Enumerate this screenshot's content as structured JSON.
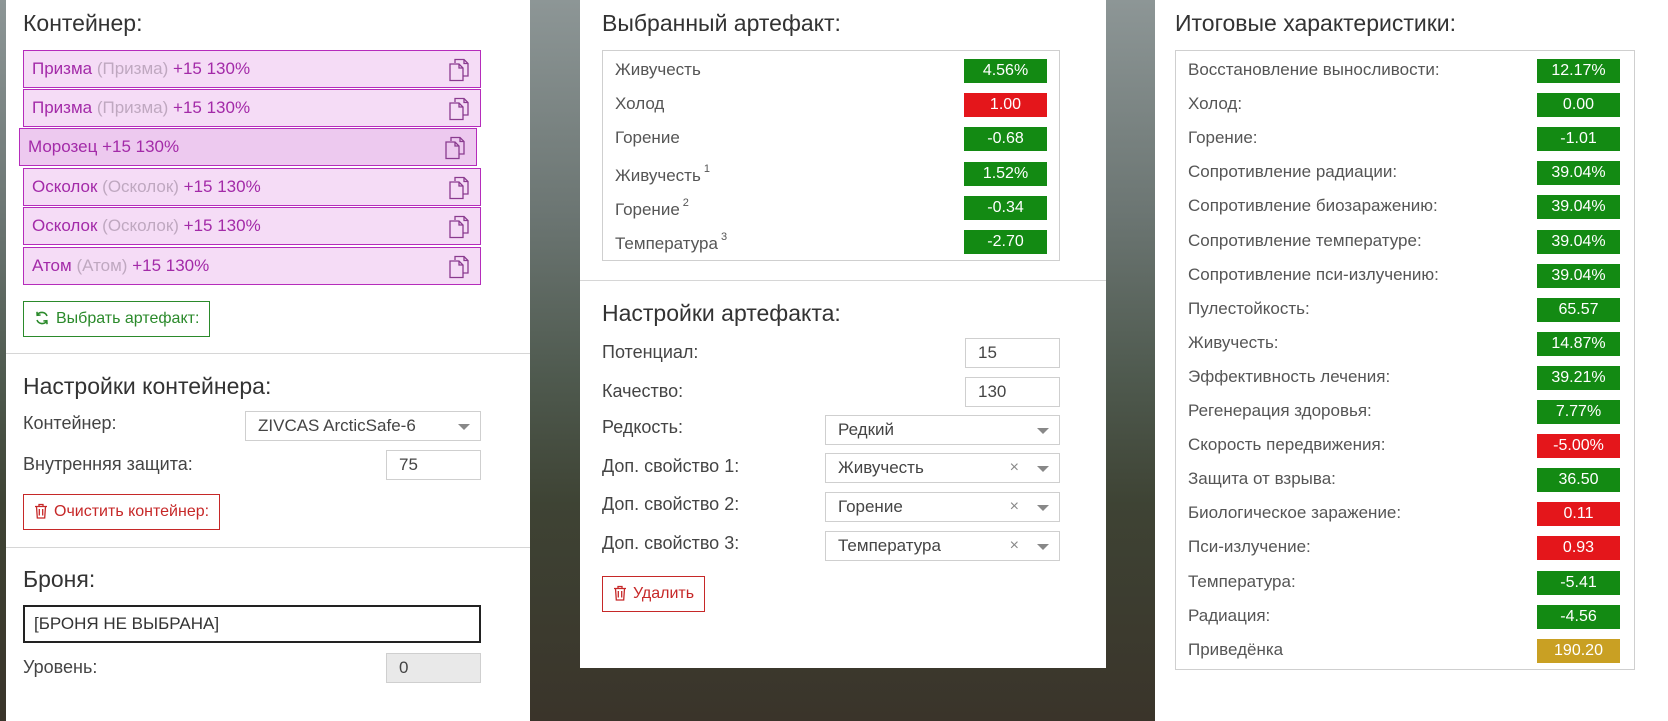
{
  "container_panel": {
    "title": "Контейнер:",
    "items": [
      {
        "name": "Призма",
        "alt": "(Призма)",
        "level": "+15 130%",
        "selected": false
      },
      {
        "name": "Призма",
        "alt": "(Призма)",
        "level": "+15 130%",
        "selected": false
      },
      {
        "name": "Морозец",
        "alt": "",
        "level": "+15 130%",
        "selected": true
      },
      {
        "name": "Осколок",
        "alt": "(Осколок)",
        "level": "+15 130%",
        "selected": false
      },
      {
        "name": "Осколок",
        "alt": "(Осколок)",
        "level": "+15 130%",
        "selected": false
      },
      {
        "name": "Атом",
        "alt": "(Атом)",
        "level": "+15 130%",
        "selected": false
      }
    ],
    "select_artifact_label": "Выбрать артефакт:"
  },
  "container_settings": {
    "title": "Настройки контейнера:",
    "container_label": "Контейнер:",
    "container_value": "ZIVCAS ArcticSafe-6",
    "protection_label": "Внутренняя защита:",
    "protection_value": "75",
    "clear_label": "Очистить контейнер:"
  },
  "armor": {
    "title": "Броня:",
    "value": "[БРОНЯ НЕ ВЫБРАНА]",
    "level_label": "Уровень:",
    "level_value": "0"
  },
  "selected_artifact": {
    "title": "Выбранный артефакт:",
    "stats": [
      {
        "label": "Живучесть",
        "sup": "",
        "value": "4.56%",
        "color": "green"
      },
      {
        "label": "Холод",
        "sup": "",
        "value": "1.00",
        "color": "red"
      },
      {
        "label": "Горение",
        "sup": "",
        "value": "-0.68",
        "color": "green"
      },
      {
        "label": "Живучесть",
        "sup": "1",
        "value": "1.52%",
        "color": "green"
      },
      {
        "label": "Горение",
        "sup": "2",
        "value": "-0.34",
        "color": "green"
      },
      {
        "label": "Температура",
        "sup": "3",
        "value": "-2.70",
        "color": "green"
      }
    ]
  },
  "artifact_settings": {
    "title": "Настройки артефакта:",
    "potential_label": "Потенциал:",
    "potential_value": "15",
    "quality_label": "Качество:",
    "quality_value": "130",
    "rarity_label": "Редкость:",
    "rarity_value": "Редкий",
    "extra1_label": "Доп. свойство 1:",
    "extra1_value": "Живучесть",
    "extra2_label": "Доп. свойство 2:",
    "extra2_value": "Горение",
    "extra3_label": "Доп. свойство 3:",
    "extra3_value": "Температура",
    "clear_glyph": "×",
    "delete_label": "Удалить"
  },
  "total_stats": {
    "title": "Итоговые характеристики:",
    "stats": [
      {
        "label": "Восстановление выносливости:",
        "value": "12.17%",
        "color": "green"
      },
      {
        "label": "Холод:",
        "value": "0.00",
        "color": "green"
      },
      {
        "label": "Горение:",
        "value": "-1.01",
        "color": "green"
      },
      {
        "label": "Сопротивление радиации:",
        "value": "39.04%",
        "color": "green"
      },
      {
        "label": "Сопротивление биозаражению:",
        "value": "39.04%",
        "color": "green"
      },
      {
        "label": "Сопротивление температуре:",
        "value": "39.04%",
        "color": "green"
      },
      {
        "label": "Сопротивление пси-излучению:",
        "value": "39.04%",
        "color": "green"
      },
      {
        "label": "Пулестойкость:",
        "value": "65.57",
        "color": "green"
      },
      {
        "label": "Живучесть:",
        "value": "14.87%",
        "color": "green"
      },
      {
        "label": "Эффективность лечения:",
        "value": "39.21%",
        "color": "green"
      },
      {
        "label": "Регенерация здоровья:",
        "value": "7.77%",
        "color": "green"
      },
      {
        "label": "Скорость передвижения:",
        "value": "-5.00%",
        "color": "red"
      },
      {
        "label": "Защита от взрыва:",
        "value": "36.50",
        "color": "green"
      },
      {
        "label": "Биологическое заражение:",
        "value": "0.11",
        "color": "red"
      },
      {
        "label": "Пси-излучение:",
        "value": "0.93",
        "color": "red"
      },
      {
        "label": "Температура:",
        "value": "-5.41",
        "color": "green"
      },
      {
        "label": "Радиация:",
        "value": "-4.56",
        "color": "green"
      },
      {
        "label": "Приведёнка",
        "value": "190.20",
        "color": "gold"
      }
    ]
  },
  "colors": {
    "green": "#138a13",
    "red": "#e4161b",
    "gold": "#c9a023",
    "purple": "#a32aa8"
  },
  "icons": {
    "copy": "copy-icon",
    "refresh": "refresh-icon",
    "trash": "trash-icon",
    "caret": "chevron-down-icon"
  }
}
